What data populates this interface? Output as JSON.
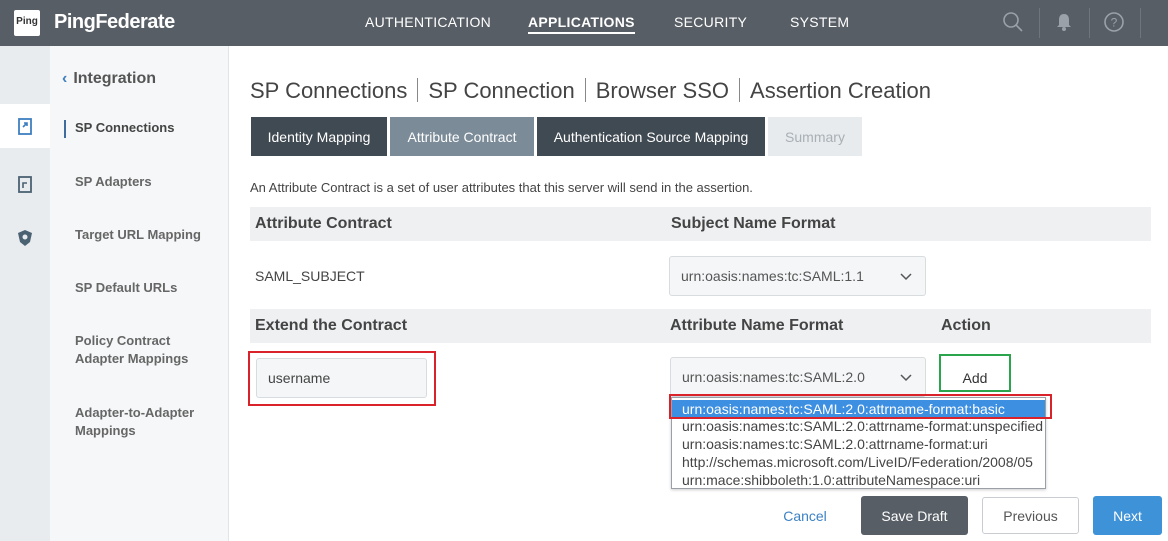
{
  "header": {
    "logo_text": "Ping",
    "brand": "PingFederate",
    "nav": [
      "AUTHENTICATION",
      "APPLICATIONS",
      "SECURITY",
      "SYSTEM"
    ],
    "help_glyph": "?"
  },
  "sidebar": {
    "back_label": "Integration",
    "items": [
      {
        "label": "SP Connections"
      },
      {
        "label": "SP Adapters"
      },
      {
        "label": "Target URL Mapping"
      },
      {
        "label": "SP Default URLs"
      },
      {
        "label": "Policy Contract Adapter Mappings"
      },
      {
        "label": "Adapter-to-Adapter Mappings"
      }
    ]
  },
  "breadcrumb": [
    "SP Connections",
    "SP Connection",
    "Browser SSO",
    "Assertion Creation"
  ],
  "tabs": [
    {
      "label": "Identity Mapping"
    },
    {
      "label": "Attribute Contract"
    },
    {
      "label": "Authentication Source Mapping"
    },
    {
      "label": "Summary"
    }
  ],
  "intro": "An Attribute Contract is a set of user attributes that this server will send in the assertion.",
  "contract_table": {
    "col1": "Attribute Contract",
    "col2": "Subject Name Format",
    "row_name": "SAML_SUBJECT",
    "row_format": "urn:oasis:names:tc:SAML:1.1"
  },
  "extend_table": {
    "col1": "Extend the Contract",
    "col2": "Attribute Name Format",
    "col3": "Action",
    "input_value": "username",
    "format_value": "urn:oasis:names:tc:SAML:2.0",
    "add_label": "Add"
  },
  "dropdown_options": [
    "urn:oasis:names:tc:SAML:2.0:attrname-format:basic",
    "urn:oasis:names:tc:SAML:2.0:attrname-format:unspecified",
    "urn:oasis:names:tc:SAML:2.0:attrname-format:uri",
    "http://schemas.microsoft.com/LiveID/Federation/2008/05",
    "urn:mace:shibboleth:1.0:attributeNamespace:uri"
  ],
  "footer": {
    "cancel": "Cancel",
    "save_draft": "Save Draft",
    "previous": "Previous",
    "next": "Next"
  },
  "colors": {
    "topbar": "#575e65",
    "accent_blue": "#3d92d8",
    "highlight_red": "#d9222a",
    "highlight_green": "#2aa54b"
  }
}
